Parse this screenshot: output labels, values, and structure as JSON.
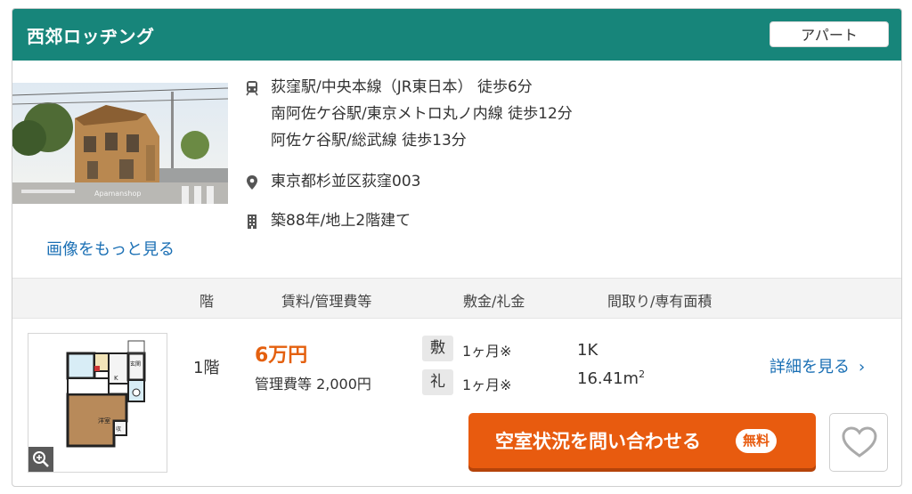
{
  "property": {
    "name": "西郊ロッヂング",
    "type_badge": "アパート"
  },
  "photo": {
    "watermark": "Apamanshop",
    "more_images_label": "画像をもっと見る"
  },
  "access": {
    "icon": "train-icon",
    "lines": [
      "荻窪駅/中央本線（JR東日本） 徒歩6分",
      "南阿佐ケ谷駅/東京メトロ丸ノ内線 徒歩12分",
      "阿佐ケ谷駅/総武線 徒歩13分"
    ]
  },
  "address": {
    "icon": "location-pin-icon",
    "text": "東京都杉並区荻窪003"
  },
  "building": {
    "icon": "building-icon",
    "text": "築88年/地上2階建て"
  },
  "table_headers": [
    "階",
    "賃料/管理費等",
    "敷金/礼金",
    "間取り/専有面積"
  ],
  "room": {
    "floor": "1階",
    "rent": "6万円",
    "management_fee": "管理費等 2,000円",
    "deposit_label": "敷",
    "deposit_value": "1ヶ月※",
    "key_money_label": "礼",
    "key_money_value": "1ヶ月※",
    "layout": "1K",
    "area": "16.41m",
    "area_unit_sup": "2",
    "floorplan_labels": {
      "western": "洋室",
      "entrance": "玄関",
      "kitchen": "K",
      "storage": "収"
    },
    "details_label": "詳細を見る",
    "details_chevron": "›",
    "cta_label": "空室状況を問い合わせる",
    "cta_free_badge": "無料"
  },
  "colors": {
    "header_bg": "#17857a",
    "rent": "#e4600f",
    "cta_bg": "#e85b0f",
    "link": "#1a6fb4"
  }
}
